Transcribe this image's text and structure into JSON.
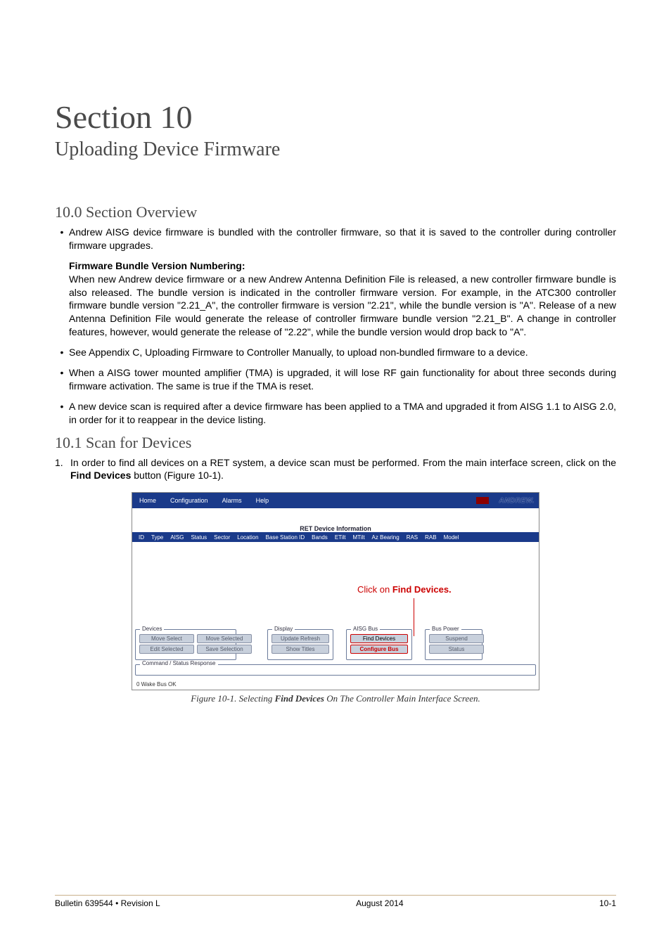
{
  "header": {
    "title": "Section 10",
    "subtitle": "Uploading Device Firmware"
  },
  "sec_overview": {
    "heading": "10.0 Section Overview",
    "bullet1": "Andrew AISG device firmware is bundled with the controller firmware, so that it is saved to the controller during controller firmware upgrades.",
    "fw_heading": "Firmware Bundle Version Numbering:",
    "fw_body": "When new Andrew device firmware or a new Andrew Antenna Definition File is released, a new controller firmware bundle is also released. The bundle version is indicated in the controller firmware version. For example, in the ATC300 controller firmware bundle version \"2.21_A\", the controller firmware is version \"2.21\", while the bundle version is \"A\". Release of a new Antenna Definition File would generate the release of controller firmware bundle version \"2.21_B\". A change in controller features, however, would generate the release of \"2.22\", while the bundle version would drop back to \"A\".",
    "bullet2": "See Appendix C, Uploading Firmware to Controller Manually, to upload non-bundled firmware to a device.",
    "bullet3": "When a AISG tower mounted amplifier (TMA) is upgraded, it will lose RF gain functionality for about three seconds during firmware activation. The same is true if the TMA is reset.",
    "bullet4": "A new device scan is required after a device firmware has been applied to a TMA and upgraded it from AISG 1.1 to AISG 2.0, in order for it to reappear in the device listing."
  },
  "sec_scan": {
    "heading": "10.1 Scan for Devices",
    "step1_pre": "In order to find all devices on a RET system, a device scan must be performed. From the main interface screen, click on the ",
    "step1_bold": "Find Devices",
    "step1_post": " button (Figure 10-1)."
  },
  "screenshot": {
    "menu": {
      "home": "Home",
      "config": "Configuration",
      "alarms": "Alarms",
      "help": "Help"
    },
    "logo": "ANDREW.",
    "info_title": "RET Device Information",
    "cols": [
      "ID",
      "Type",
      "AISG",
      "Status",
      "Sector",
      "Location",
      "Base Station ID",
      "Bands",
      "ETilt",
      "MTilt",
      "Az Bearing",
      "RAS",
      "RAB",
      "Model"
    ],
    "annot_pre": "Click on ",
    "annot_bold": "Find Devices.",
    "panels": {
      "devices": {
        "title": "Devices",
        "btn1": "Move Select",
        "btn2": "Edit Selected",
        "btn3": "Move Selected",
        "btn4": "Save Selection"
      },
      "display": {
        "title": "Display",
        "btn1": "Update Refresh",
        "btn2": "Show Titles"
      },
      "aisg": {
        "title": "AISG Bus",
        "btn1": "Find Devices",
        "btn2": "Configure Bus"
      },
      "bus": {
        "title": "Bus Power",
        "btn1": "Suspend",
        "btn2": "Status"
      }
    },
    "status_section": "Command / Status Response",
    "status_text": "0 Wake Bus OK"
  },
  "caption_pre": "Figure 10-1.  Selecting ",
  "caption_bold": "Find Devices",
  "caption_post": " On The Controller Main Interface Screen.",
  "footer": {
    "left": "Bulletin 639544  •  Revision L",
    "center": "August 2014",
    "right": "10-1"
  }
}
